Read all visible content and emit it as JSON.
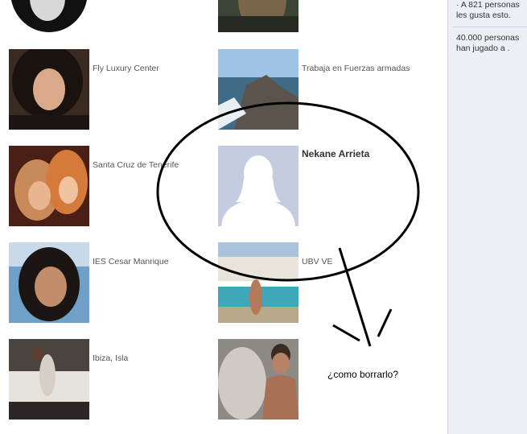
{
  "sidebar": {
    "items": [
      "· A 821 personas les gusta esto.",
      "40.000 personas han jugado a ."
    ]
  },
  "people": [
    {
      "label": "",
      "icon": "profile-photo"
    },
    {
      "label": "",
      "icon": "profile-photo"
    },
    {
      "label": "Fly Luxury Center",
      "icon": "profile-photo"
    },
    {
      "label": "Trabaja en Fuerzas armadas",
      "icon": "profile-photo"
    },
    {
      "label": "Santa Cruz de Tenerife",
      "icon": "profile-photo"
    },
    {
      "name": "Nekane Arrieta",
      "icon": "default-female-avatar"
    },
    {
      "label": "IES Cesar Manrique",
      "icon": "profile-photo"
    },
    {
      "label": "UBV VE",
      "icon": "profile-photo"
    },
    {
      "label": "Ibiza, Isla",
      "icon": "profile-photo"
    },
    {
      "label": "",
      "icon": "profile-photo"
    }
  ],
  "annotation": {
    "text": "¿como borrarlo?"
  }
}
